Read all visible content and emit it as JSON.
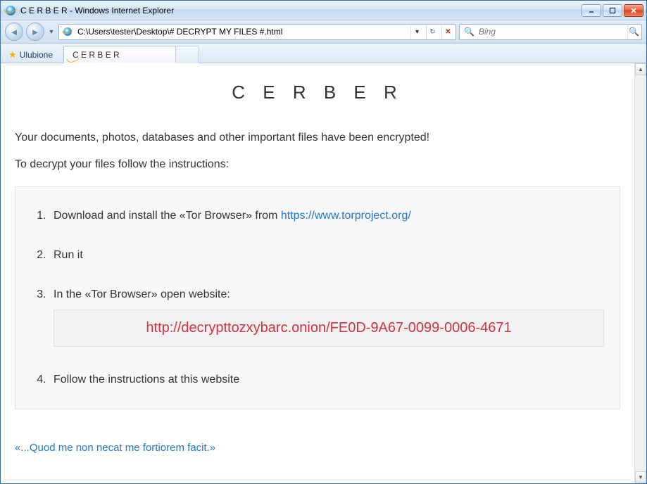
{
  "window": {
    "title": "C E R B E R - Windows Internet Explorer"
  },
  "nav": {
    "address": "C:\\Users\\tester\\Desktop\\# DECRYPT MY FILES #.html",
    "search_placeholder": "Bing"
  },
  "tabs": {
    "favorites_label": "Ulubione",
    "tab0": "C E R B E R"
  },
  "page": {
    "heading": "C E R B E R",
    "p1": "Your documents, photos, databases and other important files have been encrypted!",
    "p2": "To decrypt your files follow the instructions:",
    "step1_a": "Download and install the «Tor Browser» from ",
    "step1_link": "https://www.torproject.org/",
    "step2": "Run it",
    "step3": "In the «Tor Browser» open website:",
    "onion": "http://decrypttozxybarc.onion/FE0D-9A67-0099-0006-4671",
    "step4": "Follow the instructions at this website",
    "footer": "«...Quod me non necat me fortiorem facit.»"
  }
}
